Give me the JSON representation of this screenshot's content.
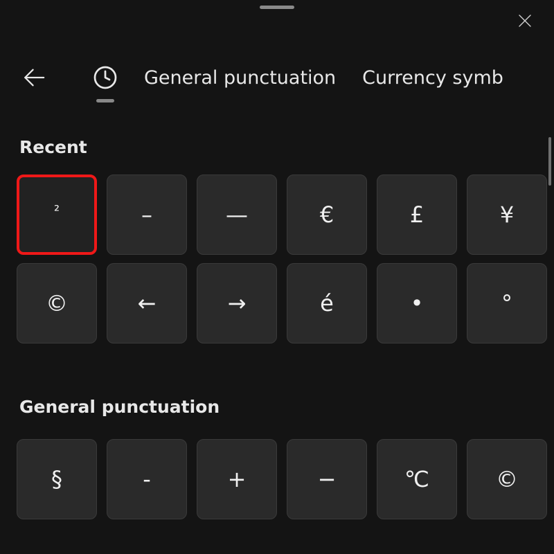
{
  "header": {
    "close_label": "Close"
  },
  "tabs": {
    "history_label": "Recent",
    "general_label": "General punctuation",
    "currency_label": "Currency symb"
  },
  "sections": {
    "recent_label": "Recent",
    "general_label": "General punctuation"
  },
  "recent_row1": [
    {
      "glyph": "²",
      "name": "superscript-two"
    },
    {
      "glyph": "–",
      "name": "en-dash"
    },
    {
      "glyph": "—",
      "name": "em-dash"
    },
    {
      "glyph": "€",
      "name": "euro-sign"
    },
    {
      "glyph": "£",
      "name": "pound-sign"
    },
    {
      "glyph": "¥",
      "name": "yen-sign"
    }
  ],
  "recent_row2": [
    {
      "glyph": "©",
      "name": "copyright-sign"
    },
    {
      "glyph": "←",
      "name": "left-arrow"
    },
    {
      "glyph": "→",
      "name": "right-arrow"
    },
    {
      "glyph": "é",
      "name": "e-acute"
    },
    {
      "glyph": "•",
      "name": "bullet"
    },
    {
      "glyph": "°",
      "name": "degree-sign"
    }
  ],
  "general_row1": [
    {
      "glyph": "§",
      "name": "section-sign"
    },
    {
      "glyph": "-",
      "name": "hyphen"
    },
    {
      "glyph": "+",
      "name": "plus-sign"
    },
    {
      "glyph": "−",
      "name": "minus-sign"
    },
    {
      "glyph": "℃",
      "name": "degree-celsius"
    },
    {
      "glyph": "©",
      "name": "copyright-sign"
    }
  ],
  "highlight_index": 0
}
